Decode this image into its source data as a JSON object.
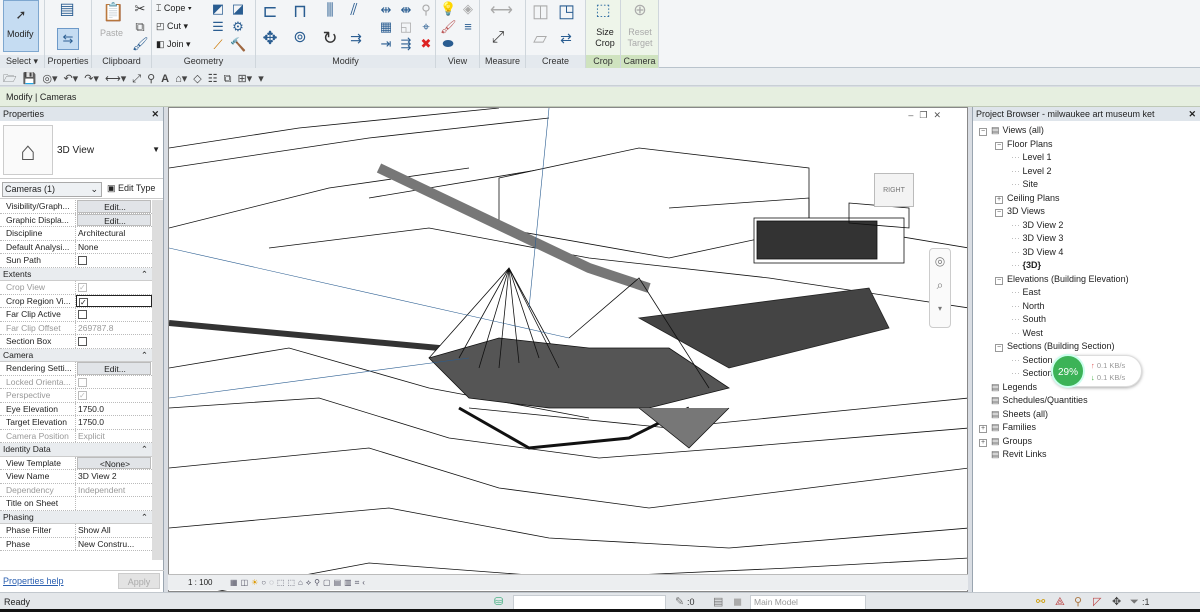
{
  "ribbon": {
    "panels": [
      {
        "label": "Select",
        "has_dropdown": true
      },
      {
        "label": "Properties"
      },
      {
        "label": "Clipboard"
      },
      {
        "label": "Geometry"
      },
      {
        "label": "Modify"
      },
      {
        "label": "View"
      },
      {
        "label": "Measure"
      },
      {
        "label": "Create"
      },
      {
        "label": "Crop"
      },
      {
        "label": "Camera"
      }
    ],
    "modify_label": "Modify",
    "paste_label": "Paste",
    "cope_label": "Cope",
    "cut_label": "Cut",
    "join_label": "Join",
    "size_crop_label": "Size Crop",
    "reset_target_label": "Reset Target",
    "accent": "#c5dcf2",
    "contextual_green": "#cfe3bf"
  },
  "context_bar": {
    "text": "Modify | Cameras"
  },
  "properties": {
    "title": "Properties",
    "type_name": "3D View",
    "type_icon": "house-icon",
    "instance_selector": "Cameras (1)",
    "edit_type": "Edit Type",
    "groups": [
      {
        "name": "",
        "rows": [
          {
            "key": "Visibility/Graph...",
            "value": "Edit...",
            "kind": "button"
          },
          {
            "key": "Graphic Displa...",
            "value": "Edit...",
            "kind": "button"
          },
          {
            "key": "Discipline",
            "value": "Architectural"
          },
          {
            "key": "Default Analysi...",
            "value": "None"
          },
          {
            "key": "Sun Path",
            "value": "",
            "kind": "checkbox",
            "checked": false
          }
        ]
      },
      {
        "name": "Extents",
        "rows": [
          {
            "key": "Crop View",
            "value": "",
            "kind": "checkbox",
            "checked": true,
            "disabled": true
          },
          {
            "key": "Crop Region Vi...",
            "value": "",
            "kind": "checkbox",
            "checked": true
          },
          {
            "key": "Far Clip Active",
            "value": "",
            "kind": "checkbox",
            "checked": false
          },
          {
            "key": "Far Clip Offset",
            "value": "269787.8",
            "disabled": true
          },
          {
            "key": "Section Box",
            "value": "",
            "kind": "checkbox",
            "checked": false
          }
        ]
      },
      {
        "name": "Camera",
        "rows": [
          {
            "key": "Rendering Setti...",
            "value": "Edit...",
            "kind": "button"
          },
          {
            "key": "Locked Orienta...",
            "value": "",
            "kind": "checkbox",
            "checked": false,
            "disabled": true
          },
          {
            "key": "Perspective",
            "value": "",
            "kind": "checkbox",
            "checked": true,
            "disabled": true
          },
          {
            "key": "Eye Elevation",
            "value": "1750.0"
          },
          {
            "key": "Target Elevation",
            "value": "1750.0"
          },
          {
            "key": "Camera Position",
            "value": "Explicit",
            "disabled": true
          }
        ]
      },
      {
        "name": "Identity Data",
        "rows": [
          {
            "key": "View Template",
            "value": "<None>",
            "kind": "button"
          },
          {
            "key": "View Name",
            "value": "3D View 2"
          },
          {
            "key": "Dependency",
            "value": "Independent",
            "disabled": true
          },
          {
            "key": "Title on Sheet",
            "value": ""
          }
        ]
      },
      {
        "name": "Phasing",
        "rows": [
          {
            "key": "Phase Filter",
            "value": "Show All"
          },
          {
            "key": "Phase",
            "value": "New Constru..."
          }
        ]
      }
    ],
    "help_link": "Properties help",
    "apply": "Apply"
  },
  "viewport": {
    "scale": "1 : 100",
    "viewcube_face": "RIGHT"
  },
  "browser": {
    "title": "Project Browser - milwaukee art museum ket",
    "items": [
      {
        "label": "Views (all)",
        "level": 0,
        "expander": "-"
      },
      {
        "label": "Floor Plans",
        "level": 1,
        "expander": "-"
      },
      {
        "label": "Level 1",
        "level": 2
      },
      {
        "label": "Level 2",
        "level": 2
      },
      {
        "label": "Site",
        "level": 2
      },
      {
        "label": "Ceiling Plans",
        "level": 1,
        "expander": "+"
      },
      {
        "label": "3D Views",
        "level": 1,
        "expander": "-"
      },
      {
        "label": "3D View 2",
        "level": 2
      },
      {
        "label": "3D View 3",
        "level": 2
      },
      {
        "label": "3D View 4",
        "level": 2
      },
      {
        "label": "{3D}",
        "level": 2,
        "bold": true
      },
      {
        "label": "Elevations (Building Elevation)",
        "level": 1,
        "expander": "-"
      },
      {
        "label": "East",
        "level": 2
      },
      {
        "label": "North",
        "level": 2
      },
      {
        "label": "South",
        "level": 2
      },
      {
        "label": "West",
        "level": 2
      },
      {
        "label": "Sections (Building Section)",
        "level": 1,
        "expander": "-"
      },
      {
        "label": "Section",
        "level": 2
      },
      {
        "label": "Section",
        "level": 2
      },
      {
        "label": "Legends",
        "level": 0
      },
      {
        "label": "Schedules/Quantities",
        "level": 0
      },
      {
        "label": "Sheets (all)",
        "level": 0
      },
      {
        "label": "Families",
        "level": 0,
        "expander": "+"
      },
      {
        "label": "Groups",
        "level": 0,
        "expander": "+"
      },
      {
        "label": "Revit Links",
        "level": 0
      }
    ]
  },
  "network_widget": {
    "percent": "29%",
    "up": "0.1 KB/s",
    "down": "0.1 KB/s",
    "color": "#3cb357"
  },
  "status": {
    "text": "Ready",
    "selection_count": ":0",
    "model": "Main Model",
    "filter_count": ":1"
  }
}
